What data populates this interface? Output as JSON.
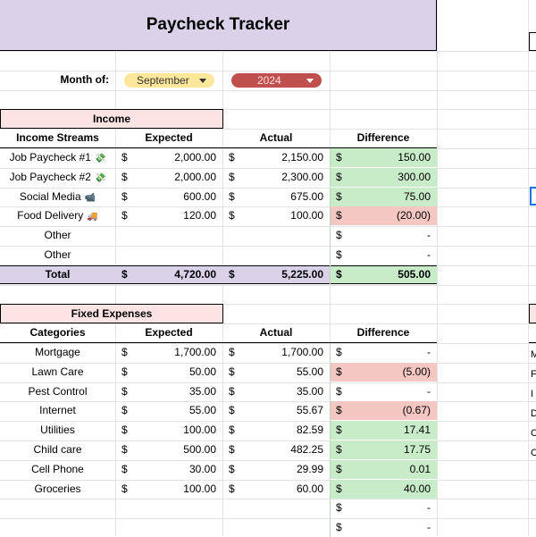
{
  "title": "Paycheck Tracker",
  "month_label": "Month of:",
  "month_value": "September",
  "year_value": "2024",
  "currency": "$",
  "colors": {
    "title_bg": "#d9d2e9",
    "month_pill": "#fde79a",
    "year_pill": "#c0504d",
    "section_bg": "#fce4e4",
    "positive": "#c8ecc8",
    "negative": "#f4c7c3",
    "total_bg": "#d9d2e9"
  },
  "income": {
    "section_label": "Income",
    "headers": [
      "Income Streams",
      "Expected",
      "Actual",
      "Difference"
    ],
    "rows": [
      {
        "name": "Job Paycheck #1",
        "icon": "money-icon",
        "emoji": "💸",
        "expected": "2,000.00",
        "actual": "2,150.00",
        "diff": "150.00",
        "status": "positive"
      },
      {
        "name": "Job Paycheck #2",
        "icon": "money-icon",
        "emoji": "💸",
        "expected": "2,000.00",
        "actual": "2,300.00",
        "diff": "300.00",
        "status": "positive"
      },
      {
        "name": "Social Media",
        "icon": "video-icon",
        "emoji": "📹",
        "expected": "600.00",
        "actual": "675.00",
        "diff": "75.00",
        "status": "positive"
      },
      {
        "name": "Food Delivery",
        "icon": "truck-icon",
        "emoji": "🚚",
        "expected": "120.00",
        "actual": "100.00",
        "diff": "(20.00)",
        "status": "negative"
      },
      {
        "name": "Other",
        "icon": "",
        "emoji": "",
        "expected": "",
        "actual": "",
        "diff": "-",
        "status": "none"
      },
      {
        "name": "Other",
        "icon": "",
        "emoji": "",
        "expected": "",
        "actual": "",
        "diff": "-",
        "status": "none"
      }
    ],
    "total": {
      "label": "Total",
      "expected": "4,720.00",
      "actual": "5,225.00",
      "diff": "505.00"
    }
  },
  "fixed": {
    "section_label": "Fixed Expenses",
    "headers": [
      "Categories",
      "Expected",
      "Actual",
      "Difference"
    ],
    "rows": [
      {
        "name": "Mortgage",
        "expected": "1,700.00",
        "actual": "1,700.00",
        "diff": "-",
        "status": "none"
      },
      {
        "name": "Lawn Care",
        "expected": "50.00",
        "actual": "55.00",
        "diff": "(5.00)",
        "status": "negative"
      },
      {
        "name": "Pest Control",
        "expected": "35.00",
        "actual": "35.00",
        "diff": "-",
        "status": "none"
      },
      {
        "name": "Internet",
        "expected": "55.00",
        "actual": "55.67",
        "diff": "(0.67)",
        "status": "negative"
      },
      {
        "name": "Utilities",
        "expected": "100.00",
        "actual": "82.59",
        "diff": "17.41",
        "status": "positive"
      },
      {
        "name": "Child care",
        "expected": "500.00",
        "actual": "482.25",
        "diff": "17.75",
        "status": "positive"
      },
      {
        "name": "Cell Phone",
        "expected": "30.00",
        "actual": "29.99",
        "diff": "0.01",
        "status": "positive"
      },
      {
        "name": "Groceries",
        "expected": "100.00",
        "actual": "60.00",
        "diff": "40.00",
        "status": "positive"
      },
      {
        "name": "",
        "expected": "",
        "actual": "",
        "diff": "-",
        "status": "none"
      },
      {
        "name": "",
        "expected": "",
        "actual": "",
        "diff": "-",
        "status": "none"
      }
    ]
  },
  "right_edge_letters": [
    "M",
    "F",
    "I",
    "D",
    "C",
    "C"
  ]
}
